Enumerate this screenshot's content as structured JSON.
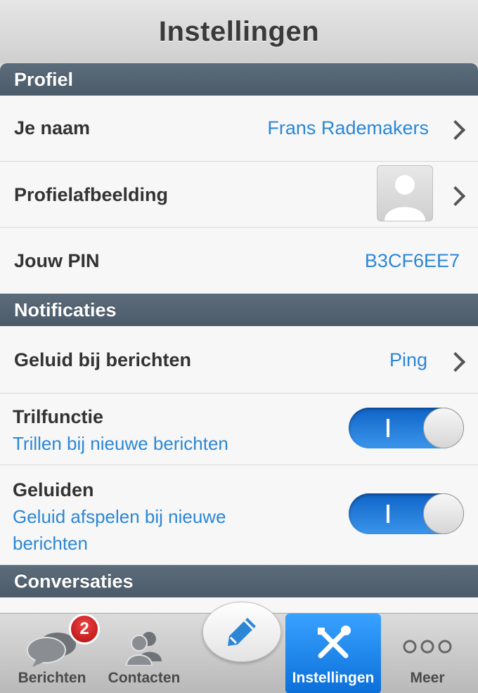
{
  "header": {
    "title": "Instellingen"
  },
  "sections": {
    "profiel": {
      "title": "Profiel"
    },
    "notificaties": {
      "title": "Notificaties"
    },
    "conversaties": {
      "title": "Conversaties"
    }
  },
  "rows": {
    "naam": {
      "label": "Je naam",
      "value": "Frans Rademakers"
    },
    "profielafbeelding": {
      "label": "Profielafbeelding"
    },
    "pin": {
      "label": "Jouw PIN",
      "value": "B3CF6EE7"
    },
    "geluid": {
      "label": "Geluid bij berichten",
      "value": "Ping"
    },
    "trilfunctie": {
      "label": "Trilfunctie",
      "sublabel": "Trillen bij nieuwe berichten",
      "on": true
    },
    "geluiden": {
      "label": "Geluiden",
      "sublabel_line1": "Geluid afspelen bij nieuwe",
      "sublabel_line2": "berichten",
      "on": true
    }
  },
  "tabbar": {
    "berichten": {
      "label": "Berichten",
      "badge": "2"
    },
    "contacten": {
      "label": "Contacten"
    },
    "instellingen": {
      "label": "Instellingen"
    },
    "meer": {
      "label": "Meer"
    }
  },
  "colors": {
    "accent": "#2b87d6",
    "section_header": "#4f5f6d",
    "toggle_on": "#1f7ee0",
    "badge": "#d11f1f"
  },
  "icons": {
    "chevron": "chevron-right-icon",
    "avatar": "avatar-placeholder-icon",
    "berichten": "chat-bubbles-icon",
    "contacten": "contacts-icon",
    "compose": "pencil-icon",
    "instellingen": "tools-icon",
    "meer": "more-dots-icon"
  }
}
